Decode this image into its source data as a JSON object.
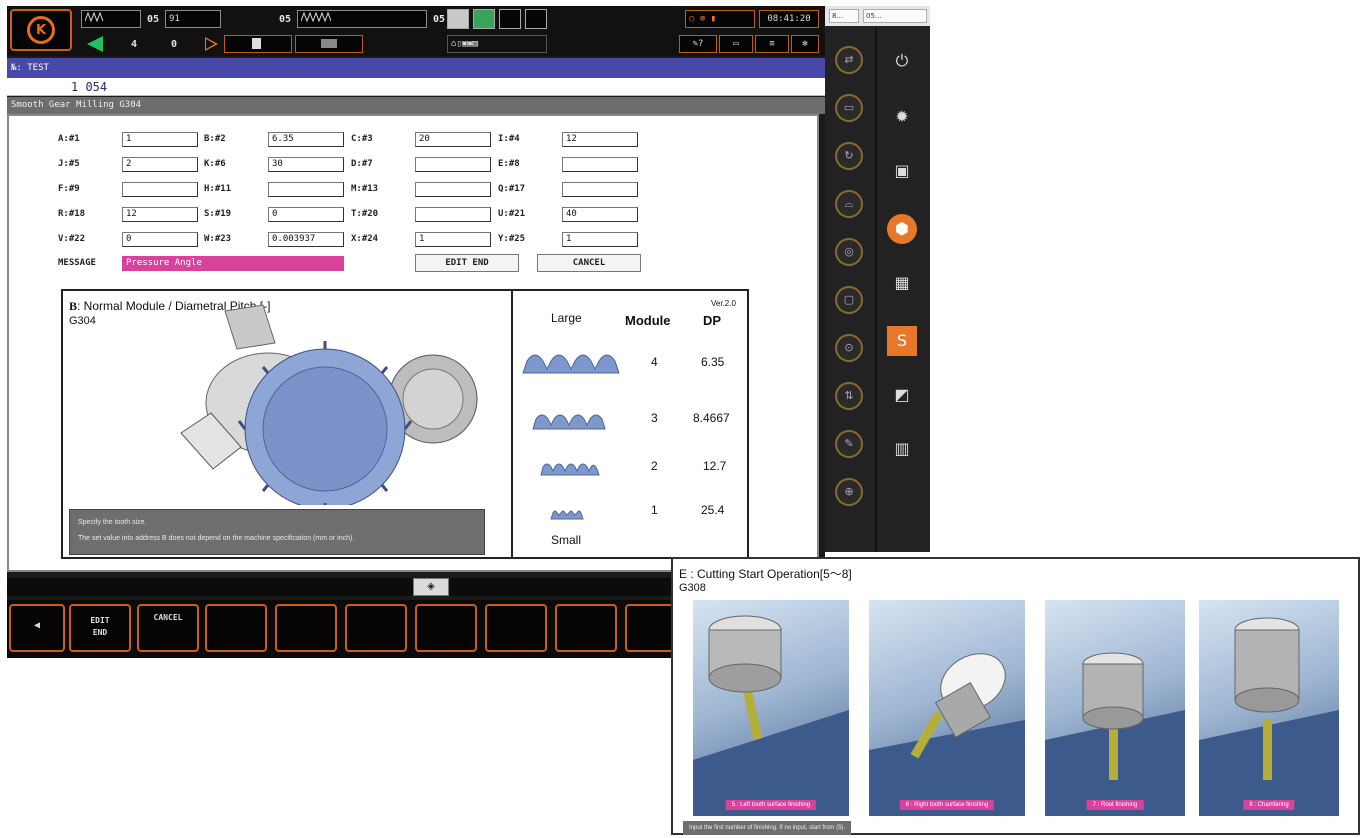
{
  "status_bar": {
    "mode_a": "05",
    "mode_b": "05",
    "mode_c": "05",
    "box_code": "91",
    "counter_left": "4",
    "counter_right": "0",
    "clock": "08:41:20"
  },
  "program": {
    "title": "№: TEST",
    "number": "1 054",
    "subtitle": "Smooth Gear Milling G304"
  },
  "fields": [
    {
      "label": "A:#1",
      "value": "1"
    },
    {
      "label": "B:#2",
      "value": "6.35"
    },
    {
      "label": "C:#3",
      "value": "20"
    },
    {
      "label": "I:#4",
      "value": "12"
    },
    {
      "label": "J:#5",
      "value": "2"
    },
    {
      "label": "K:#6",
      "value": "30"
    },
    {
      "label": "D:#7",
      "value": ""
    },
    {
      "label": "E:#8",
      "value": ""
    },
    {
      "label": "F:#9",
      "value": ""
    },
    {
      "label": "H:#11",
      "value": ""
    },
    {
      "label": "M:#13",
      "value": ""
    },
    {
      "label": "Q:#17",
      "value": ""
    },
    {
      "label": "R:#18",
      "value": "12"
    },
    {
      "label": "S:#19",
      "value": "0"
    },
    {
      "label": "T:#20",
      "value": ""
    },
    {
      "label": "U:#21",
      "value": "40"
    },
    {
      "label": "V:#22",
      "value": "0"
    },
    {
      "label": "W:#23",
      "value": "0.003937"
    },
    {
      "label": "X:#24",
      "value": "1"
    },
    {
      "label": "Y:#25",
      "value": "1"
    }
  ],
  "message": {
    "label": "MESSAGE",
    "value": "Pressure Angle"
  },
  "buttons": {
    "edit_end": "EDIT END",
    "cancel": "CANCEL"
  },
  "diagram": {
    "title_letter": "B",
    "title_text": ": Normal Module / Diametral Pitch [-]",
    "code": "G304",
    "help_line1": "Specify the tooth size.",
    "help_line2": "The set value into address B does not depend on the machine specification (mm or inch).",
    "version": "Ver.2.0",
    "col_large": "Large",
    "col_module": "Module",
    "col_dp": "DP",
    "col_small": "Small",
    "rows": [
      {
        "module": "4",
        "dp": "6.35"
      },
      {
        "module": "3",
        "dp": "8.4667"
      },
      {
        "module": "2",
        "dp": "12.7"
      },
      {
        "module": "1",
        "dp": "25.4"
      }
    ]
  },
  "softkeys": {
    "back": "◀",
    "edit_end_l1": "EDIT",
    "edit_end_l2": "END",
    "cancel": "CANCEL"
  },
  "side_panel": {
    "tab1": "8...",
    "tab2": "05..."
  },
  "panel_e": {
    "title": "E : Cutting Start Operation[5～8]",
    "code": "G308",
    "steps": [
      "5 : Left tooth surface finishing",
      "6 : Right tooth surface finishing",
      "7 : Root finishing",
      "8 : Chamfering"
    ],
    "footer": "Input the first number of finishing. If no input, start from (5)."
  }
}
